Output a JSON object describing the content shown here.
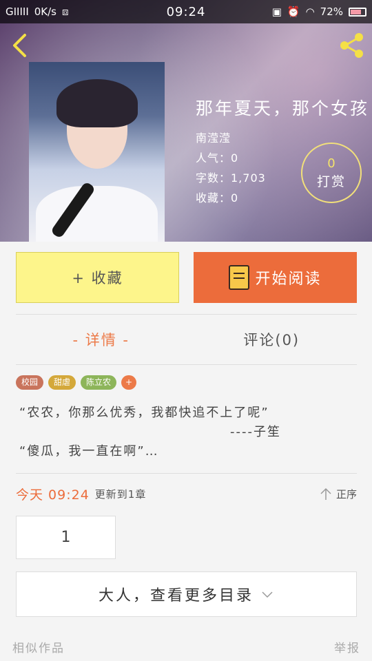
{
  "status_bar": {
    "signal": "GIIIII",
    "speed": "0K/s",
    "time": "09:24",
    "battery_pct": "72%"
  },
  "book": {
    "title": "那年夏天，那个女孩",
    "author": "南滢滢",
    "popularity": "人气：0",
    "word_count": "字数：1,703",
    "favorites": "收藏：0"
  },
  "tip": {
    "count": "0",
    "label": "打赏"
  },
  "actions": {
    "favorite_label": "+ 收藏",
    "read_label": "开始阅读"
  },
  "tabs": [
    {
      "label": "- 详情 -"
    },
    {
      "label": "评论(0)"
    }
  ],
  "tags": [
    {
      "label": "校园",
      "color": "#c9745c"
    },
    {
      "label": "甜虐",
      "color": "#d4a83a"
    },
    {
      "label": "陈立农",
      "color": "#8db55a"
    },
    {
      "label": "+",
      "color": "#ec7a48"
    }
  ],
  "description": {
    "line1": "“农农，你那么优秀，我都快追不上了呢”",
    "author_line": "----子笙",
    "line2": "“傻瓜，我一直在啊”…"
  },
  "update": {
    "time": "今天 09:24",
    "text": "更新到1章",
    "sort_label": "正序"
  },
  "chapter": {
    "label": "1"
  },
  "more_directory": {
    "label": "大人，查看更多目录"
  },
  "footer": {
    "similar": "相似作品",
    "report": "举报"
  },
  "colors": {
    "accent": "#ec6c3b",
    "favorite_bg": "#fdf58b",
    "tip_ring": "#f2e07a"
  }
}
